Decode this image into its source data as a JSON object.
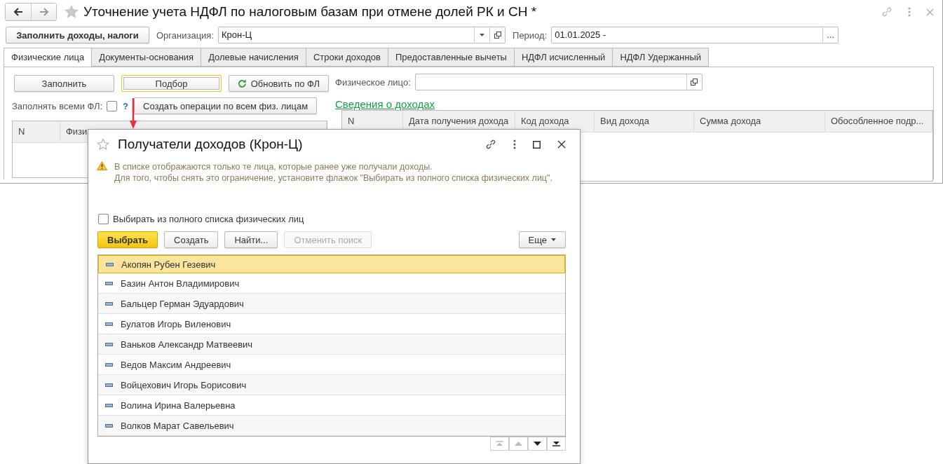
{
  "window": {
    "title": "Уточнение учета НДФЛ по налоговым базам при отмене долей РК и СН *"
  },
  "toolbar": {
    "fill_button": "Заполнить доходы, налоги",
    "organization_label": "Организация:",
    "organization": "Крон-Ц",
    "period_label": "Период:",
    "period": "01.01.2025 -",
    "period_button": "..."
  },
  "tabs": [
    {
      "label": "Физические лица",
      "selected": true
    },
    {
      "label": "Документы-основания",
      "selected": false
    },
    {
      "label": "Долевые начисления",
      "selected": false
    },
    {
      "label": "Строки доходов",
      "selected": false
    },
    {
      "label": "Предоставленные вычеты",
      "selected": false
    },
    {
      "label": "НДФЛ исчисленный",
      "selected": false
    },
    {
      "label": "НДФЛ Удержанный",
      "selected": false
    }
  ],
  "left_panel": {
    "buttons": [
      {
        "label": "Заполнить",
        "kind": "plain",
        "focused": false
      },
      {
        "label": "Подбор",
        "kind": "plain",
        "focused": true
      },
      {
        "label": "Обновить по ФЛ",
        "kind": "refresh",
        "focused": false
      }
    ],
    "fill_all_label": "Заполнять всеми ФЛ:",
    "fill_all_checked": false,
    "help": "?",
    "create_button": "Создать операции по всем физ. лицам",
    "columns": [
      "N",
      "Физи"
    ]
  },
  "right_panel": {
    "person_label": "Физическое лицо:",
    "income_link": "Сведения о доходах",
    "columns": [
      "N",
      "Дата получения дохода",
      "Код дохода",
      "Вид дохода",
      "Сумма дохода",
      "Обособленное подр..."
    ]
  },
  "dialog": {
    "title": "Получатели доходов (Крон-Ц)",
    "warning": [
      "В списке отображаются только те лица, которые ранее уже получали доходы.",
      "Для того, чтобы снять это ограничение, установите флажок \"Выбирать из полного списка физических лиц\"."
    ],
    "full_list_label": "Выбирать из полного списка физических лиц",
    "full_list_checked": false,
    "buttons": [
      {
        "label": "Выбрать",
        "kind": "primary"
      },
      {
        "label": "Создать",
        "kind": "default"
      },
      {
        "label": "Найти...",
        "kind": "default"
      },
      {
        "label": "Отменить поиск",
        "kind": "disabled"
      }
    ],
    "more_button": "Еще",
    "rows": [
      {
        "name": "Акопян Рубен Гезевич",
        "selected": true
      },
      {
        "name": "Базин Антон Владимирович",
        "selected": false
      },
      {
        "name": "Бальцер Герман Эдуардович",
        "selected": false
      },
      {
        "name": "Булатов Игорь Виленович",
        "selected": false
      },
      {
        "name": "Ваньков Александр Матвеевич",
        "selected": false
      },
      {
        "name": "Ведов Максим Андреевич",
        "selected": false
      },
      {
        "name": "Войцехович Игорь Борисович",
        "selected": false
      },
      {
        "name": "Волина Ирина Валерьевна",
        "selected": false
      },
      {
        "name": "Волков Марат Савельевич",
        "selected": false
      }
    ]
  }
}
